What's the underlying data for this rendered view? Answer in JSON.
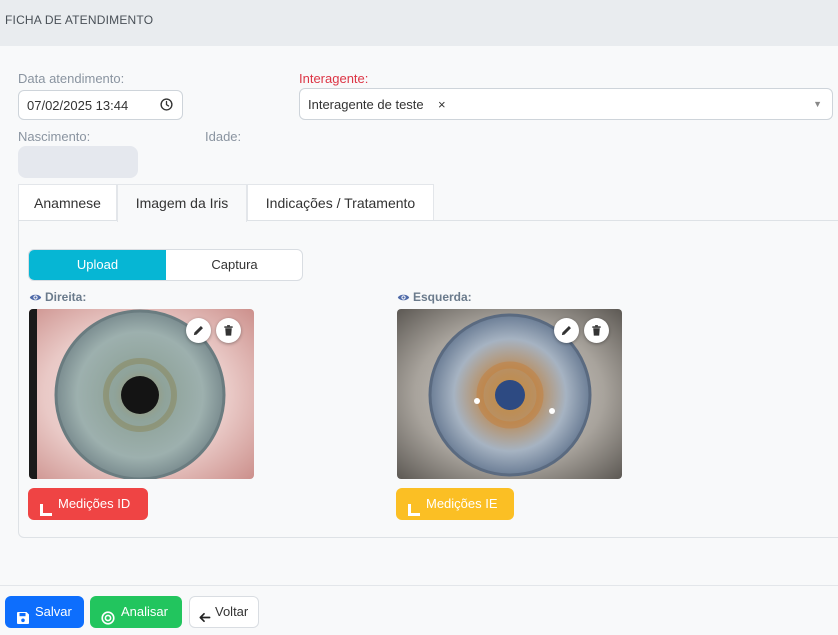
{
  "header": {
    "title": "FICHA DE ATENDIMENTO"
  },
  "form": {
    "date_label": "Data atendimento:",
    "date_value": "07/02/2025 13:44",
    "interagente_label": "Interagente:",
    "interagente_value": "Interagente de teste",
    "interagente_remove": "×",
    "birth_label": "Nascimento:",
    "age_label": "Idade:"
  },
  "tabs": [
    {
      "label": "Anamnese",
      "active": false
    },
    {
      "label": "Imagem da Iris",
      "active": true
    },
    {
      "label": "Indicações / Tratamento",
      "active": false
    }
  ],
  "iris": {
    "segments": {
      "upload": "Upload",
      "capture": "Captura",
      "selected": "Upload"
    },
    "right": {
      "label": "Direita:",
      "button": "Medições ID"
    },
    "left": {
      "label": "Esquerda:",
      "button": "Medições IE"
    }
  },
  "footer": {
    "save": "Salvar",
    "analyze": "Analisar",
    "back": "Voltar"
  },
  "colors": {
    "accent_cyan": "#06b6d4",
    "primary_blue": "#0d6efd",
    "success_green": "#22c55e",
    "danger_red": "#ef4444",
    "warning_yellow": "#fbbf24",
    "required_red": "#dc3545"
  },
  "icons": [
    "clock-icon",
    "chevron-down-icon",
    "eye-icon",
    "pencil-icon",
    "trash-icon",
    "ruler-icon",
    "save-icon",
    "analyze-icon",
    "arrow-left-icon"
  ]
}
